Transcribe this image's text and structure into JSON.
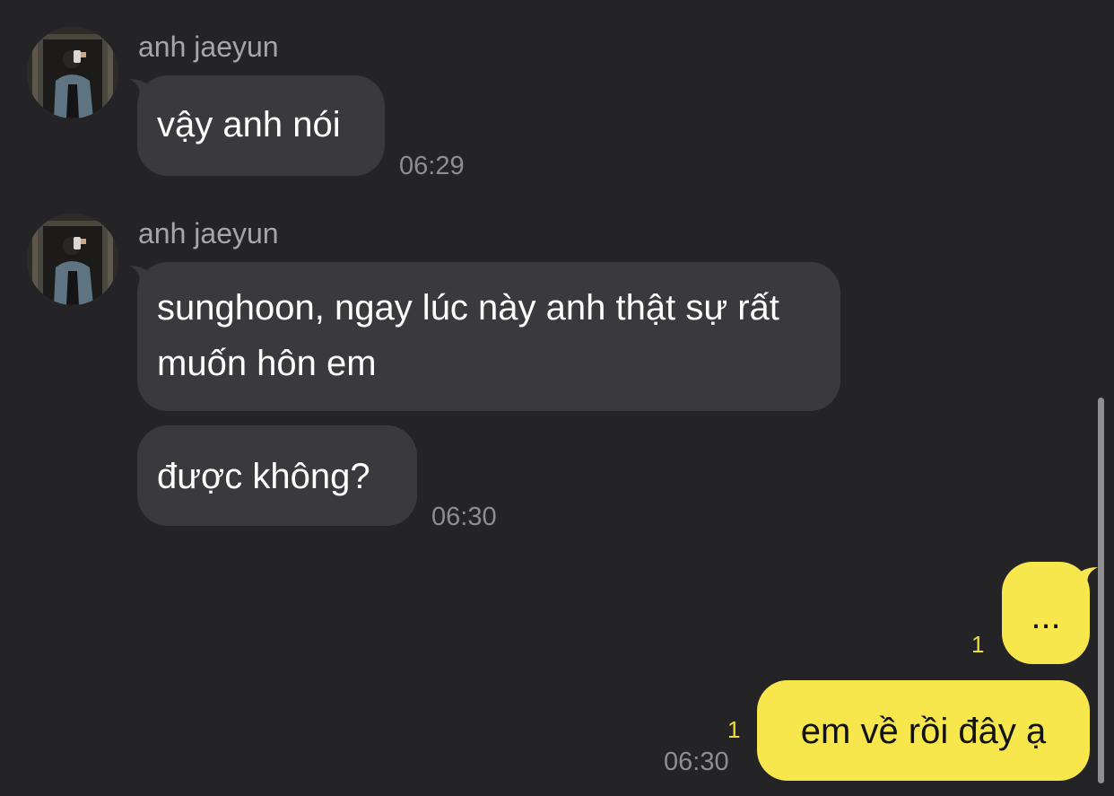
{
  "conversation": {
    "groups": [
      {
        "sender": "anh jaeyun",
        "avatar_icon": "profile-photo",
        "messages": [
          "vậy anh nói"
        ],
        "time": "06:29"
      },
      {
        "sender": "anh jaeyun",
        "avatar_icon": "profile-photo",
        "messages": [
          "sunghoon, ngay lúc này anh thật sự rất muốn hôn em",
          "được không?"
        ],
        "time": "06:30"
      }
    ],
    "outgoing": [
      {
        "text": "...",
        "unread_count": "1"
      },
      {
        "text": "em về rồi đây ạ",
        "unread_count": "1",
        "time": "06:30"
      }
    ]
  },
  "colors": {
    "background": "#242426",
    "incoming_bubble": "#3a3a3c",
    "outgoing_bubble": "#f7e74c",
    "unread_count": "#f2dc3a"
  }
}
